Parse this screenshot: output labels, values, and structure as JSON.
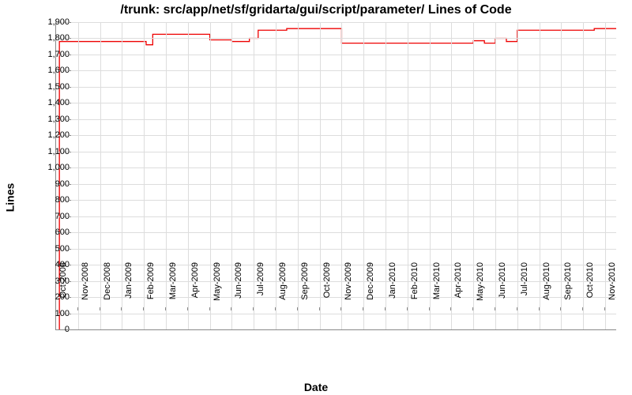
{
  "chart_data": {
    "type": "line",
    "title": "/trunk: src/app/net/sf/gridarta/gui/script/parameter/ Lines of Code",
    "xlabel": "Date",
    "ylabel": "Lines",
    "ylim": [
      0,
      1900
    ],
    "y_ticks": [
      0,
      100,
      200,
      300,
      400,
      500,
      600,
      700,
      800,
      900,
      1000,
      1100,
      1200,
      1300,
      1400,
      1500,
      1600,
      1700,
      1800,
      1900
    ],
    "x_categories": [
      "Oct-2008",
      "Nov-2008",
      "Dec-2008",
      "Jan-2009",
      "Feb-2009",
      "Mar-2009",
      "Apr-2009",
      "May-2009",
      "Jun-2009",
      "Jul-2009",
      "Aug-2009",
      "Sep-2009",
      "Oct-2009",
      "Nov-2009",
      "Dec-2009",
      "Jan-2010",
      "Feb-2010",
      "Mar-2010",
      "Apr-2010",
      "May-2010",
      "Jun-2010",
      "Jul-2010",
      "Aug-2010",
      "Sep-2010",
      "Oct-2010",
      "Nov-2010"
    ],
    "series": [
      {
        "name": "Lines of Code",
        "color": "#ee0000",
        "points": [
          [
            0.15,
            0
          ],
          [
            0.15,
            1780
          ],
          [
            4.1,
            1780
          ],
          [
            4.1,
            1760
          ],
          [
            4.4,
            1760
          ],
          [
            4.4,
            1825
          ],
          [
            7.0,
            1825
          ],
          [
            7.0,
            1790
          ],
          [
            8.0,
            1790
          ],
          [
            8.0,
            1780
          ],
          [
            8.8,
            1780
          ],
          [
            8.8,
            1800
          ],
          [
            9.2,
            1800
          ],
          [
            9.2,
            1850
          ],
          [
            10.5,
            1850
          ],
          [
            10.5,
            1860
          ],
          [
            13.0,
            1860
          ],
          [
            13.0,
            1770
          ],
          [
            19.0,
            1770
          ],
          [
            19.0,
            1785
          ],
          [
            19.5,
            1785
          ],
          [
            19.5,
            1770
          ],
          [
            20.0,
            1770
          ],
          [
            20.0,
            1800
          ],
          [
            20.5,
            1800
          ],
          [
            20.5,
            1780
          ],
          [
            21.0,
            1780
          ],
          [
            21.0,
            1850
          ],
          [
            24.5,
            1850
          ],
          [
            24.5,
            1860
          ],
          [
            25.5,
            1860
          ]
        ]
      }
    ]
  }
}
